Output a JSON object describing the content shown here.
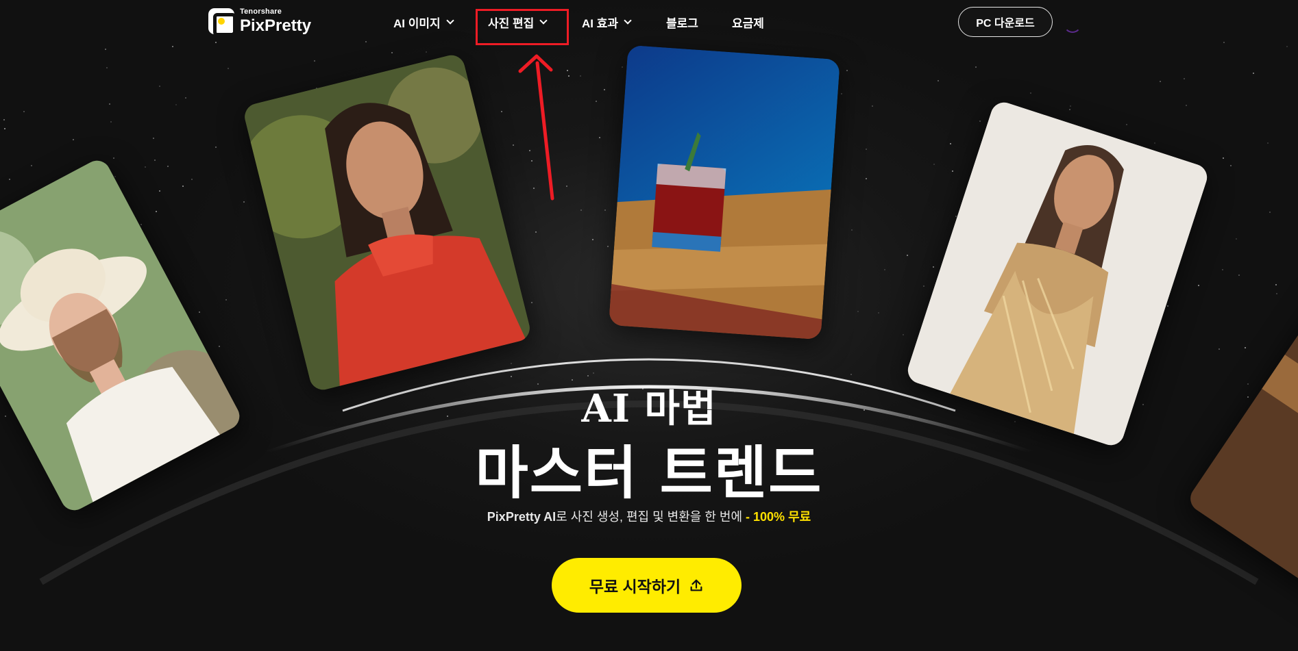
{
  "logo": {
    "company": "Tenorshare",
    "brand": "PixPretty"
  },
  "nav": {
    "items": [
      {
        "label": "AI 이미지",
        "dropdown": true
      },
      {
        "label": "사진 편집",
        "dropdown": true
      },
      {
        "label": "AI 효과",
        "dropdown": true
      },
      {
        "label": "블로그",
        "dropdown": false
      },
      {
        "label": "요금제",
        "dropdown": false
      }
    ],
    "download_label": "PC 다운로드"
  },
  "hero": {
    "subtitle": "AI 마법",
    "title": "마스터 트렌드",
    "desc_brand": "PixPretty AI",
    "desc_main": "로 사진 생성, 편집 및 변환을 한 번에",
    "desc_highlight": " - 100% 무료",
    "cta_label": "무료 시작하기"
  },
  "cards": [
    {
      "icon": "portrait-woman-white-hat-photo"
    },
    {
      "icon": "portrait-woman-red-blouse-photo"
    },
    {
      "icon": "cocktail-glass-photo"
    },
    {
      "icon": "woman-gold-dress-photo"
    },
    {
      "icon": "wooden-desk-photo"
    }
  ],
  "colors": {
    "accent": "#ffec00",
    "annotation": "#ee1c25",
    "background": "#121212"
  }
}
